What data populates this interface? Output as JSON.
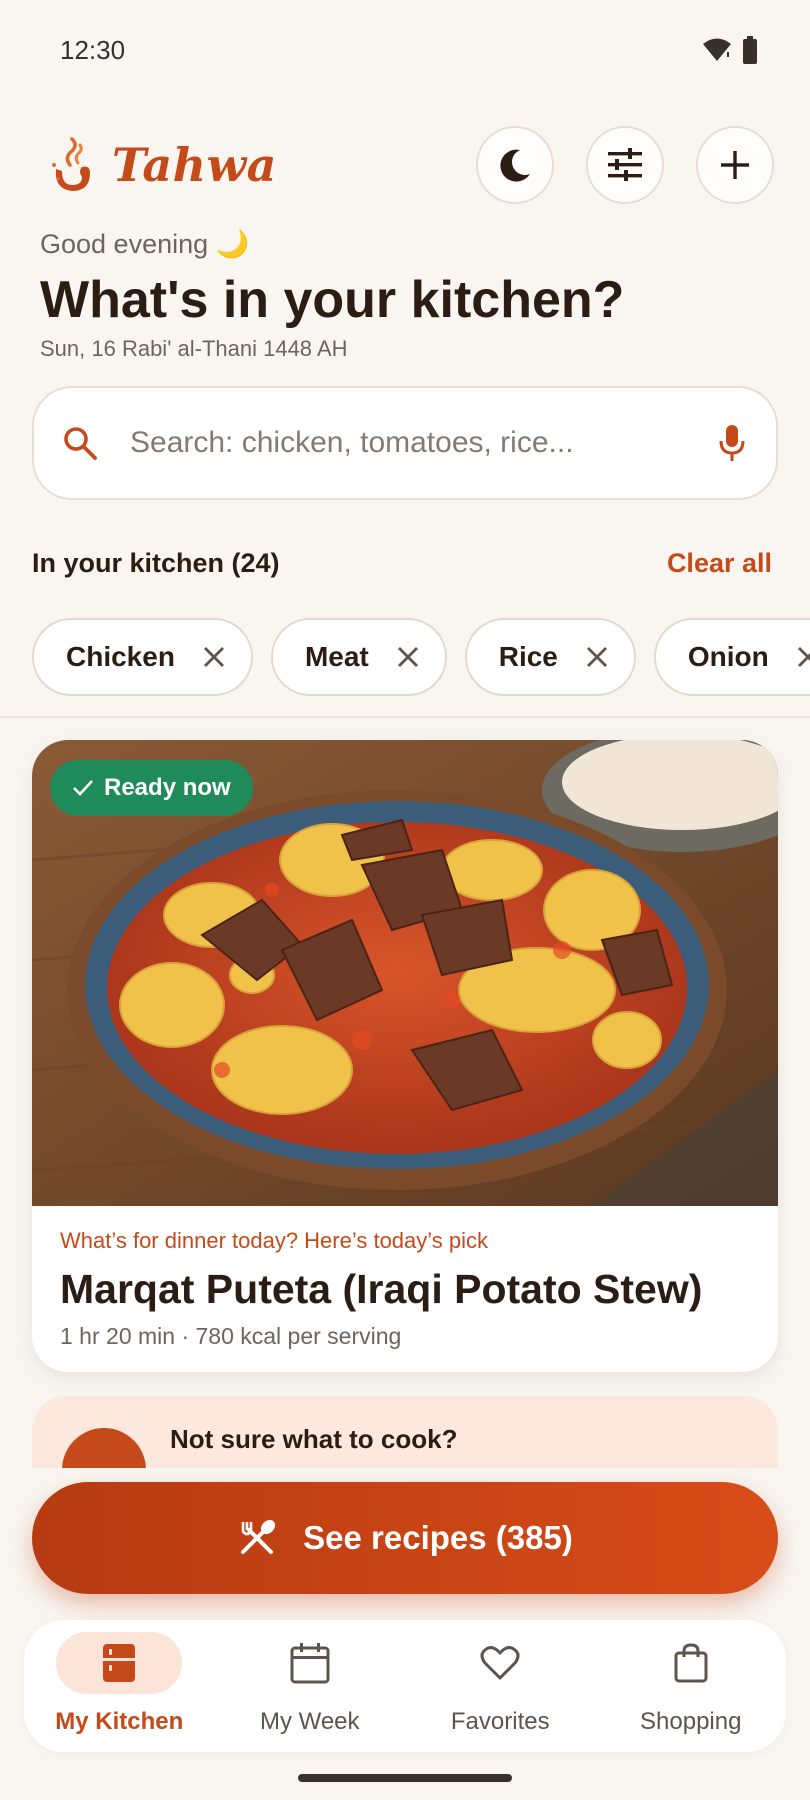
{
  "status_bar": {
    "time": "12:30",
    "icons": [
      "wifi-icon",
      "battery-icon"
    ]
  },
  "header": {
    "brand_name": "Tahwa",
    "actions": [
      "moon-icon",
      "sliders-icon",
      "plus-icon"
    ]
  },
  "greeting": {
    "text": "Good evening 🌙",
    "title": "What's in your kitchen?",
    "date": "Sun, 16 Rabi' al-Thani 1448 AH"
  },
  "search": {
    "placeholder": "Search: chicken, tomatoes, rice..."
  },
  "kitchen": {
    "title": "In your kitchen (24)",
    "clear_label": "Clear all",
    "chips": [
      "Chicken",
      "Meat",
      "Rice",
      "Onion"
    ]
  },
  "featured": {
    "badge": "Ready now",
    "kicker": "What’s for dinner today? Here’s today’s pick",
    "name": "Marqat Puteta (Iraqi Potato Stew)",
    "meta": "1 hr 20 min · 780 kcal per serving"
  },
  "suggestion": {
    "title": "Not sure what to cook?"
  },
  "cta": {
    "label": "See recipes (385)"
  },
  "nav": {
    "items": [
      {
        "label": "My Kitchen",
        "icon": "fridge-icon",
        "active": true
      },
      {
        "label": "My Week",
        "icon": "calendar-icon",
        "active": false
      },
      {
        "label": "Favorites",
        "icon": "heart-icon",
        "active": false
      },
      {
        "label": "Shopping",
        "icon": "bag-icon",
        "active": false
      }
    ]
  },
  "colors": {
    "accent": "#c44a1a",
    "background": "#f9f6f2",
    "success": "#1f8a5a",
    "active_nav_bg": "#fde4d8"
  }
}
